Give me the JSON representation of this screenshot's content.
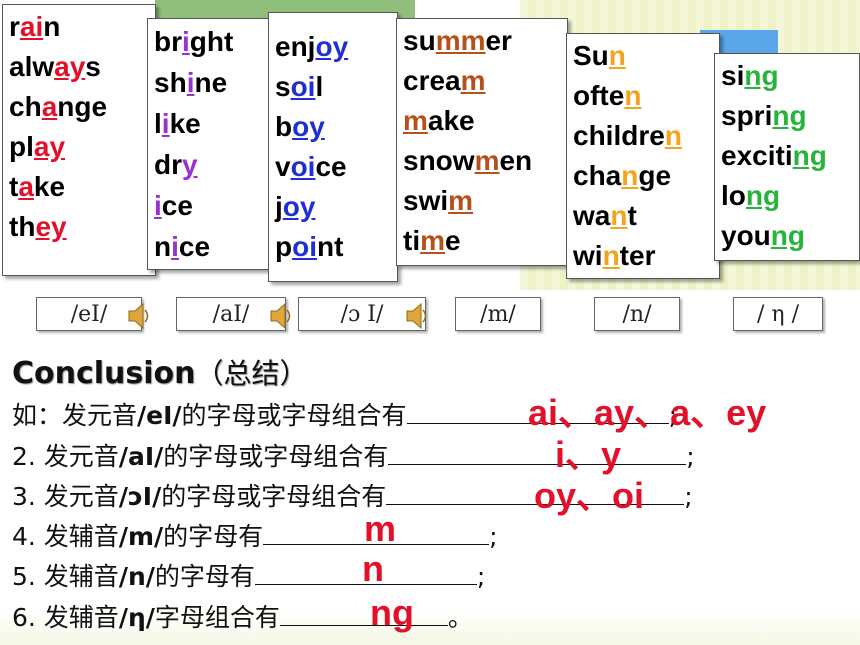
{
  "columns": [
    {
      "name": "col-ei",
      "words": [
        {
          "pre": "r",
          "hl": "ai",
          "post": "n"
        },
        {
          "pre": "alw",
          "hl": "ay",
          "post": "s"
        },
        {
          "pre": "ch",
          "hl": "a",
          "post": "nge"
        },
        {
          "pre": "pl",
          "hl": "ay",
          "post": ""
        },
        {
          "pre": "t",
          "hl": "a",
          "post": "ke"
        },
        {
          "pre": "th",
          "hl": "ey",
          "post": ""
        }
      ]
    },
    {
      "name": "col-ai",
      "words": [
        {
          "pre": "br",
          "hl": "i",
          "post": "ght"
        },
        {
          "pre": "sh",
          "hl": "i",
          "post": "ne"
        },
        {
          "pre": "l",
          "hl": "i",
          "post": "ke"
        },
        {
          "pre": "dr",
          "hl": "y",
          "post": ""
        },
        {
          "pre": "",
          "hl": "i",
          "post": "ce"
        },
        {
          "pre": "n",
          "hl": "i",
          "post": "ce"
        }
      ]
    },
    {
      "name": "col-oi",
      "words": [
        {
          "pre": "enj",
          "hl": "oy",
          "post": ""
        },
        {
          "pre": "s",
          "hl": "oi",
          "post": "l"
        },
        {
          "pre": "b",
          "hl": "oy",
          "post": ""
        },
        {
          "pre": "v",
          "hl": "oi",
          "post": "ce"
        },
        {
          "pre": "j",
          "hl": "oy",
          "post": ""
        },
        {
          "pre": "p",
          "hl": "oi",
          "post": "nt"
        }
      ]
    },
    {
      "name": "col-m",
      "words": [
        {
          "pre": "su",
          "hl": "mm",
          "post": "er"
        },
        {
          "pre": "crea",
          "hl": "m",
          "post": ""
        },
        {
          "pre": "",
          "hl": "m",
          "post": "ake"
        },
        {
          "pre": "snow",
          "hl": "m",
          "post": "en"
        },
        {
          "pre": "swi",
          "hl": "m",
          "post": ""
        },
        {
          "pre": "ti",
          "hl": "m",
          "post": "e"
        }
      ]
    },
    {
      "name": "col-n",
      "words": [
        {
          "pre": "Su",
          "hl": "n",
          "post": ""
        },
        {
          "pre": "ofte",
          "hl": "n",
          "post": ""
        },
        {
          "pre": "childre",
          "hl": "n",
          "post": ""
        },
        {
          "pre": "cha",
          "hl": "n",
          "post": "ge"
        },
        {
          "pre": "wa",
          "hl": "n",
          "post": "t"
        },
        {
          "pre": "wi",
          "hl": "n",
          "post": "ter"
        }
      ]
    },
    {
      "name": "col-ng",
      "words": [
        {
          "pre": "si",
          "hl": "ng",
          "post": ""
        },
        {
          "pre": "spri",
          "hl": "ng",
          "post": ""
        },
        {
          "pre": "exciti",
          "hl": "ng",
          "post": ""
        },
        {
          "pre": "lo",
          "hl": "ng",
          "post": ""
        },
        {
          "pre": "you",
          "hl": "ng",
          "post": ""
        }
      ]
    }
  ],
  "highlight_colors": {
    "col-ei": "#e3102a",
    "col-ai": "#9a2fd2",
    "col-oi": "#1f2fd6",
    "col-m": "#b4511b",
    "col-n": "#f2a51c",
    "col-ng": "#25b53a"
  },
  "phonetics": [
    "/eI/",
    "/aI/",
    "/ɔ I/",
    "/m/",
    "/n/",
    "/ η /"
  ],
  "conclusion": {
    "title": "Conclusion",
    "title_paren": "（总结）",
    "lines": [
      {
        "pre": "如：发元音",
        "ph": "/eI/",
        "post": "的字母或字母组合有",
        "end": ";",
        "answer": "ai、ay、a、ey"
      },
      {
        "pre": "2. 发元音",
        "ph": "/aI/",
        "post": "的字母或字母组合有",
        "end": ";",
        "answer": "i、y"
      },
      {
        "pre": "3. 发元音",
        "ph": "/ɔI/",
        "post": "的字母或字母组合有",
        "end": ";",
        "answer": "oy、oi"
      },
      {
        "pre": "4. 发辅音",
        "ph": "/m/",
        "post": "的字母有",
        "end": ";",
        "answer": "m"
      },
      {
        "pre": "5. 发辅音",
        "ph": "/n/",
        "post": "的字母有",
        "end": ";",
        "answer": "n"
      },
      {
        "pre": "6. 发辅音",
        "ph": "/η/",
        "post": "字母组合有",
        "end": "。",
        "answer": "ng"
      }
    ]
  }
}
